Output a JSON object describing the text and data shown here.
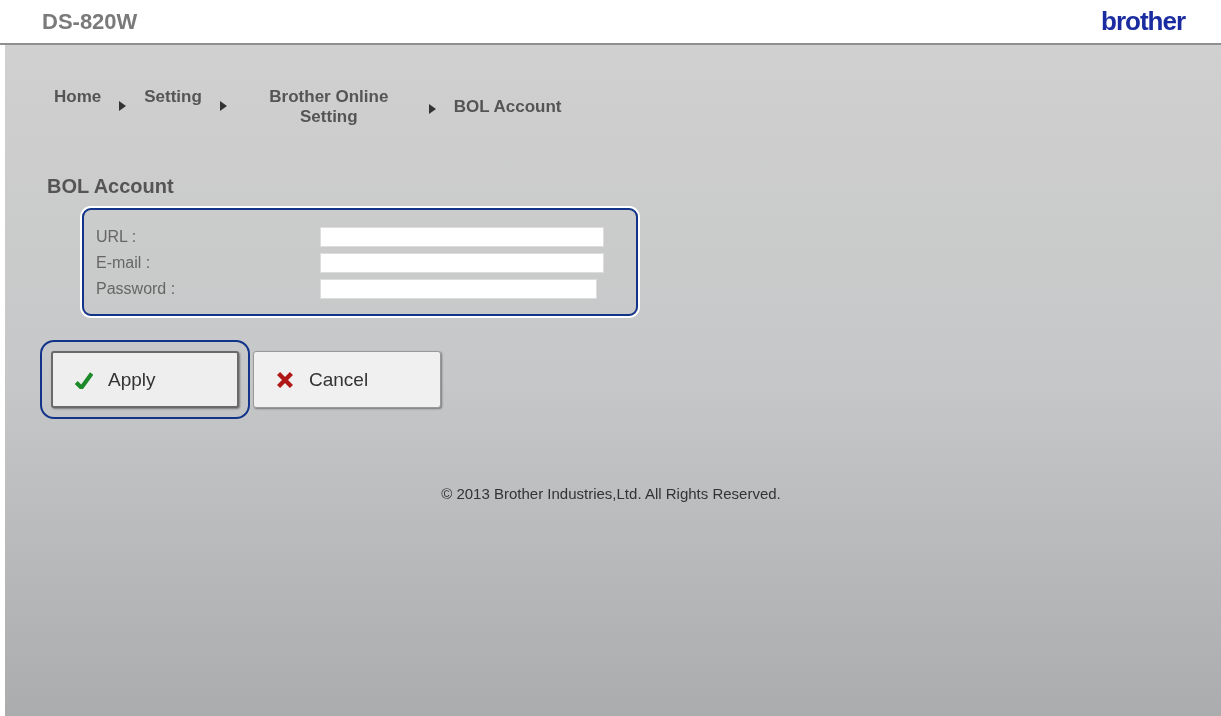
{
  "header": {
    "model": "DS-820W",
    "logo": "brother"
  },
  "breadcrumb": [
    {
      "label": "Home"
    },
    {
      "label": "Setting"
    },
    {
      "label": "Brother Online Setting"
    },
    {
      "label": "BOL Account"
    }
  ],
  "heading": "BOL Account",
  "form": {
    "focused": true,
    "fields": [
      {
        "label": "URL :"
      },
      {
        "label": "E-mail :"
      },
      {
        "label": "Password :"
      }
    ]
  },
  "buttons": [
    {
      "kind": "apply",
      "label": "Apply",
      "focused": true
    },
    {
      "kind": "cancel",
      "label": "Cancel",
      "focused": false
    }
  ],
  "footer": "© 2013 Brother Industries,Ltd. All Rights Reserved."
}
